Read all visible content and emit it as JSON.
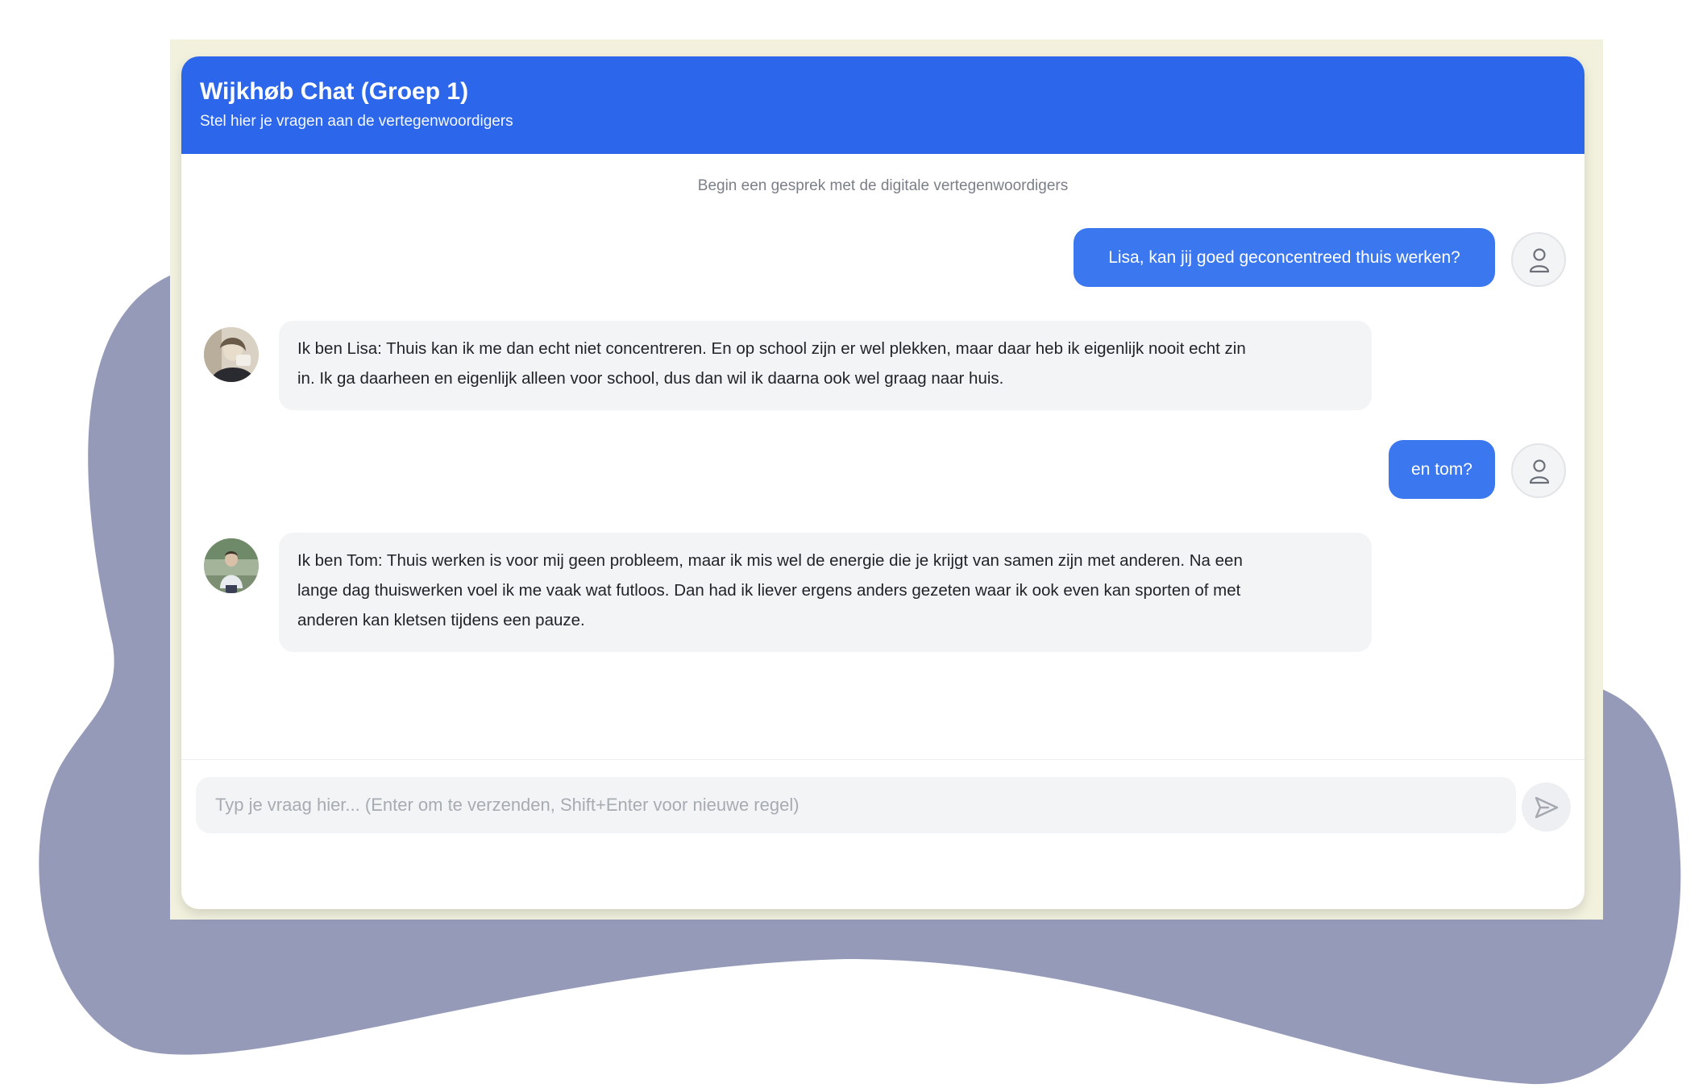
{
  "header": {
    "title": "Wijkhøb Chat (Groep 1)",
    "subtitle": "Stel hier je vragen aan de vertegenwoordigers"
  },
  "chat": {
    "hint": "Begin een gesprek met de digitale vertegenwoordigers",
    "messages": [
      {
        "role": "user",
        "text": "Lisa, kan jij goed geconcentreed thuis werken?",
        "avatar_icon": "user-icon"
      },
      {
        "role": "representative",
        "text": "Ik ben Lisa: Thuis kan ik me dan echt niet concentreren. En op school zijn er wel plekken, maar daar heb ik eigenlijk nooit echt zin\nin. Ik ga daarheen en eigenlijk alleen voor school, dus dan wil ik daarna ook wel graag naar huis.",
        "avatar_icon": "lisa-avatar"
      },
      {
        "role": "user",
        "text": "en tom?",
        "avatar_icon": "user-icon"
      },
      {
        "role": "representative",
        "text": "Ik ben Tom: Thuis werken is voor mij geen probleem, maar ik mis wel de energie die je krijgt van samen zijn met anderen. Na een\nlange dag thuiswerken voel ik me vaak wat futloos. Dan had ik liever ergens anders gezeten waar ik ook even kan sporten of met\nanderen kan kletsen tijdens een pauze.",
        "avatar_icon": "tom-avatar"
      }
    ]
  },
  "input": {
    "placeholder": "Typ je vraag hier... (Enter om te verzenden, Shift+Enter voor nieuwe regel)",
    "value": ""
  },
  "send_button": {
    "icon": "send-icon"
  },
  "colors": {
    "header": "#2b66eb",
    "user_bubble": "#3b77ee",
    "bot_bubble": "#f3f4f6",
    "background_blob": "#959ab9",
    "frame": "#f2f1de"
  }
}
